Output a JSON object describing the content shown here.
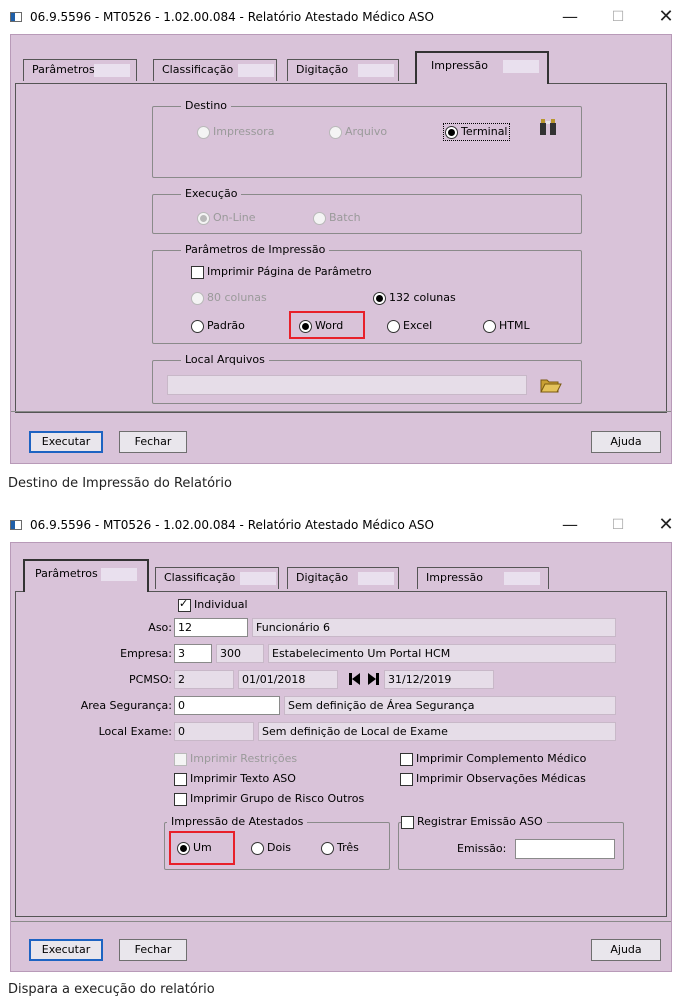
{
  "window1": {
    "title": "06.9.5596 - MT0526 - 1.02.00.084 - Relatório Atestado Médico ASO",
    "controls": {
      "minimize": "—",
      "maximize": "☐",
      "close": "✕"
    },
    "tabs": [
      "Parâmetros",
      "Classificação",
      "Digitação",
      "Impressão"
    ],
    "active_tab": "Impressão",
    "destino": {
      "label": "Destino",
      "options": [
        "Impressora",
        "Arquivo",
        "Terminal"
      ],
      "selected": "Terminal"
    },
    "execucao": {
      "label": "Execução",
      "options": [
        "On-Line",
        "Batch"
      ],
      "selected": "On-Line"
    },
    "parametros_impressao": {
      "label": "Parâmetros de Impressão",
      "imprimir_pagina": "Imprimir Página de Parâmetro",
      "col80": "80 colunas",
      "col132": "132 colunas",
      "formats": [
        "Padrão",
        "Word",
        "Excel",
        "HTML"
      ],
      "selected_format": "Word"
    },
    "local_arquivos": {
      "label": "Local Arquivos",
      "value": ""
    },
    "buttons": {
      "executar": "Executar",
      "fechar": "Fechar",
      "ajuda": "Ajuda"
    },
    "caption": "Destino de Impressão do Relatório"
  },
  "window2": {
    "title": "06.9.5596 - MT0526 - 1.02.00.084 - Relatório Atestado Médico ASO",
    "controls": {
      "minimize": "—",
      "maximize": "☐",
      "close": "✕"
    },
    "tabs": [
      "Parâmetros",
      "Classificação",
      "Digitação",
      "Impressão"
    ],
    "active_tab": "Parâmetros",
    "individual": "Individual",
    "aso": {
      "label": "Aso:",
      "value": "12",
      "desc": "Funcionário 6"
    },
    "empresa": {
      "label": "Empresa:",
      "value": "3",
      "code": "300",
      "desc": "Estabelecimento Um Portal HCM"
    },
    "pcmso": {
      "label": "PCMSO:",
      "value": "2",
      "date_start": "01/01/2018",
      "date_end": "31/12/2019"
    },
    "area_seguranca": {
      "label": "Area Segurança:",
      "value": "0",
      "desc": "Sem definição de Área Segurança"
    },
    "local_exame": {
      "label": "Local Exame:",
      "value": "0",
      "desc": "Sem definição de Local de Exame"
    },
    "checks": {
      "restricoes": "Imprimir Restrições",
      "texto_aso": "Imprimir Texto ASO",
      "grupo_risco": "Imprimir Grupo de Risco Outros",
      "complemento": "Imprimir Complemento Médico",
      "observacoes": "Imprimir Observações Médicas"
    },
    "impressao_atestados": {
      "label": "Impressão de Atestados",
      "options": [
        "Um",
        "Dois",
        "Três"
      ],
      "selected": "Um"
    },
    "registrar": {
      "label": "Registrar Emissão ASO",
      "emissao_label": "Emissão:",
      "emissao_value": ""
    },
    "buttons": {
      "executar": "Executar",
      "fechar": "Fechar",
      "ajuda": "Ajuda"
    },
    "caption": "Dispara a execução do relatório"
  },
  "colors": {
    "panel": "#d9c3d9",
    "highlight": "#e8202a",
    "default_button": "#1d63c2"
  }
}
